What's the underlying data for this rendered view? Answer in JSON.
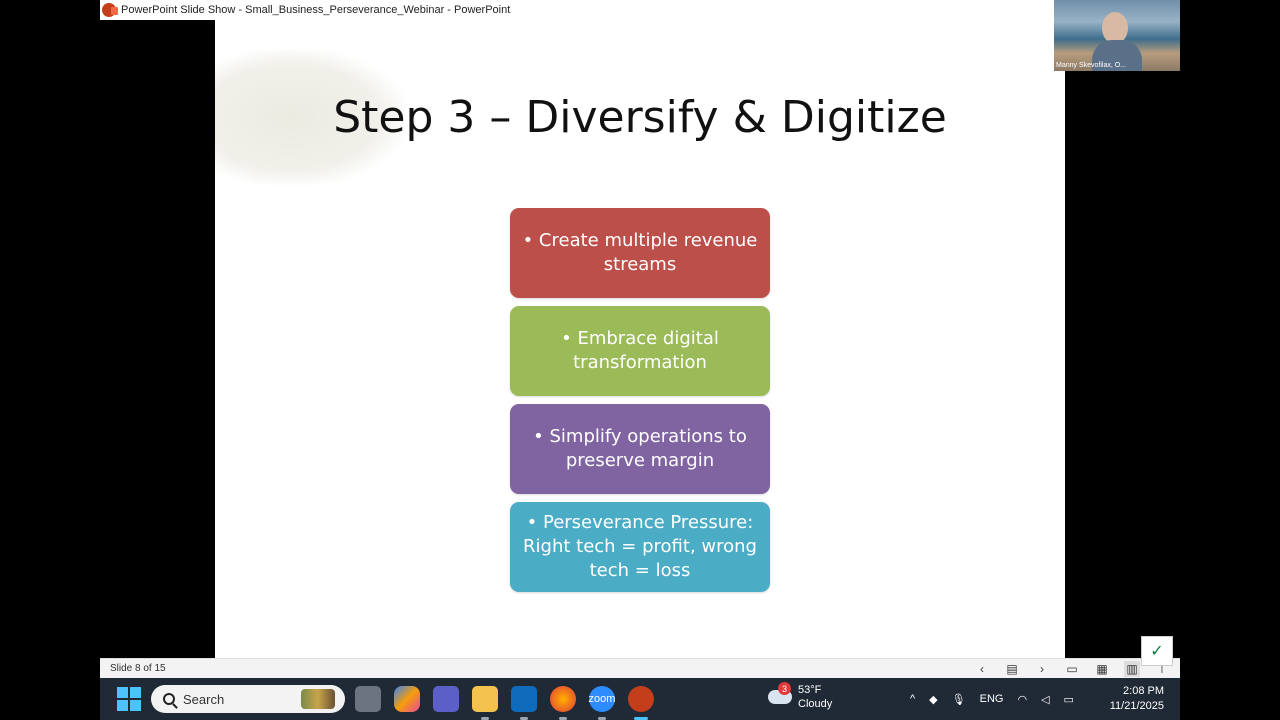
{
  "window": {
    "title": "PowerPoint Slide Show  -  Small_Business_Perseverance_Webinar - PowerPoint"
  },
  "slide": {
    "title": "Step 3 – Diversify & Digitize",
    "boxes": [
      {
        "text": "• Create multiple revenue streams",
        "color": "#bd4f4a"
      },
      {
        "text": "• Embrace digital transformation",
        "color": "#9bbb59"
      },
      {
        "text": "• Simplify operations to preserve margin",
        "color": "#8064a2"
      },
      {
        "text": "• Perseverance Pressure: Right tech = profit, wrong tech = loss",
        "color": "#4bacc6"
      }
    ]
  },
  "webcam": {
    "participant_name": "Manny Skevofilax, O..."
  },
  "statusbar": {
    "slide_counter": "Slide 8 of 15",
    "icons": [
      "prev-arrow-icon",
      "slide-list-icon",
      "next-arrow-icon",
      "normal-view-icon",
      "slide-sorter-icon",
      "reading-view-icon",
      "slideshow-icon"
    ]
  },
  "taskbar": {
    "search_label": "Search",
    "apps": [
      "task-view",
      "copilot",
      "teams",
      "file-explorer",
      "outlook",
      "firefox",
      "zoom",
      "powerpoint"
    ],
    "zoom_label": "zoom",
    "weather": {
      "badge": "3",
      "temp": "53°F",
      "condition": "Cloudy"
    },
    "language": "ENG",
    "time": "2:08 PM",
    "date": "11/21/2025",
    "accent": "#4cc2ff"
  }
}
